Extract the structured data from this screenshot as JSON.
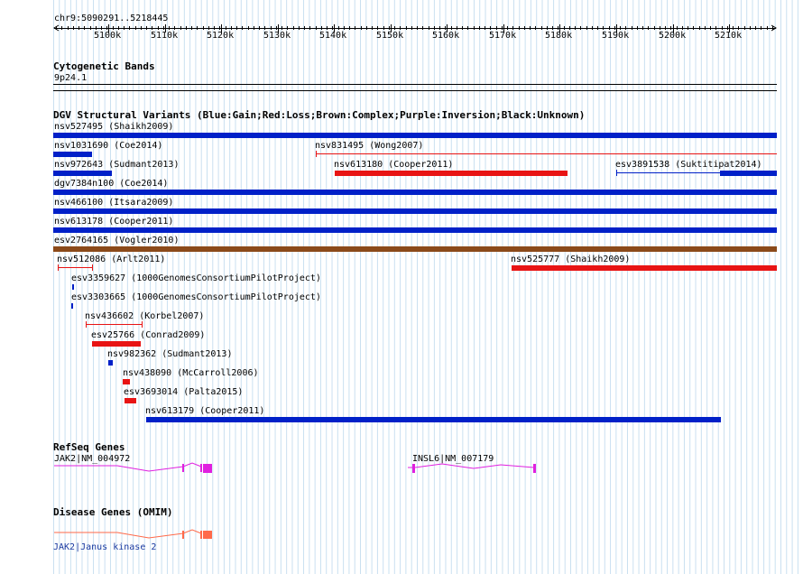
{
  "ruler": {
    "position": "chr9:5090291..5218445",
    "ticks": [
      "5100k",
      "5110k",
      "5120k",
      "5130k",
      "5140k",
      "5150k",
      "5160k",
      "5170k",
      "5180k",
      "5190k",
      "5200k",
      "5210k"
    ]
  },
  "cyto": {
    "title": "Cytogenetic Bands",
    "band": "9p24.1"
  },
  "dgv": {
    "title": "DGV Structural Variants (Blue:Gain;Red:Loss;Brown:Complex;Purple:Inversion;Black:Unknown)",
    "colors": {
      "gain": "#0020c8",
      "loss": "#e81414",
      "complex": "#8b4a1a"
    },
    "variants": [
      {
        "label": "nsv527495 (Shaikh2009)"
      },
      {
        "label": "nsv1031690 (Coe2014)"
      },
      {
        "label": "nsv831495 (Wong2007)"
      },
      {
        "label": "nsv972643 (Sudmant2013)"
      },
      {
        "label": "nsv613180 (Cooper2011)"
      },
      {
        "label": "esv3891538 (Suktitipat2014)"
      },
      {
        "label": "dgv7384n100 (Coe2014)"
      },
      {
        "label": "nsv466100 (Itsara2009)"
      },
      {
        "label": "nsv613178 (Cooper2011)"
      },
      {
        "label": "esv2764165 (Vogler2010)"
      },
      {
        "label": "nsv512086 (Arlt2011)"
      },
      {
        "label": "nsv525777 (Shaikh2009)"
      },
      {
        "label": "esv3359627 (1000GenomesConsortiumPilotProject)"
      },
      {
        "label": "esv3303665 (1000GenomesConsortiumPilotProject)"
      },
      {
        "label": "nsv436602 (Korbel2007)"
      },
      {
        "label": "esv25766 (Conrad2009)"
      },
      {
        "label": "nsv982362 (Sudmant2013)"
      },
      {
        "label": "nsv438090 (McCarroll2006)"
      },
      {
        "label": "esv3693014 (Palta2015)"
      },
      {
        "label": "nsv613179 (Cooper2011)"
      }
    ]
  },
  "refseq": {
    "title": "RefSeq Genes",
    "genes": [
      {
        "label": "JAK2|NM_004972"
      },
      {
        "label": "INSL6|NM_007179"
      }
    ],
    "color": "#e020e0"
  },
  "omim": {
    "title": "Disease Genes (OMIM)",
    "genes": [
      {
        "label": "JAK2|Janus kinase 2"
      }
    ],
    "color": "#ff6a4a"
  }
}
